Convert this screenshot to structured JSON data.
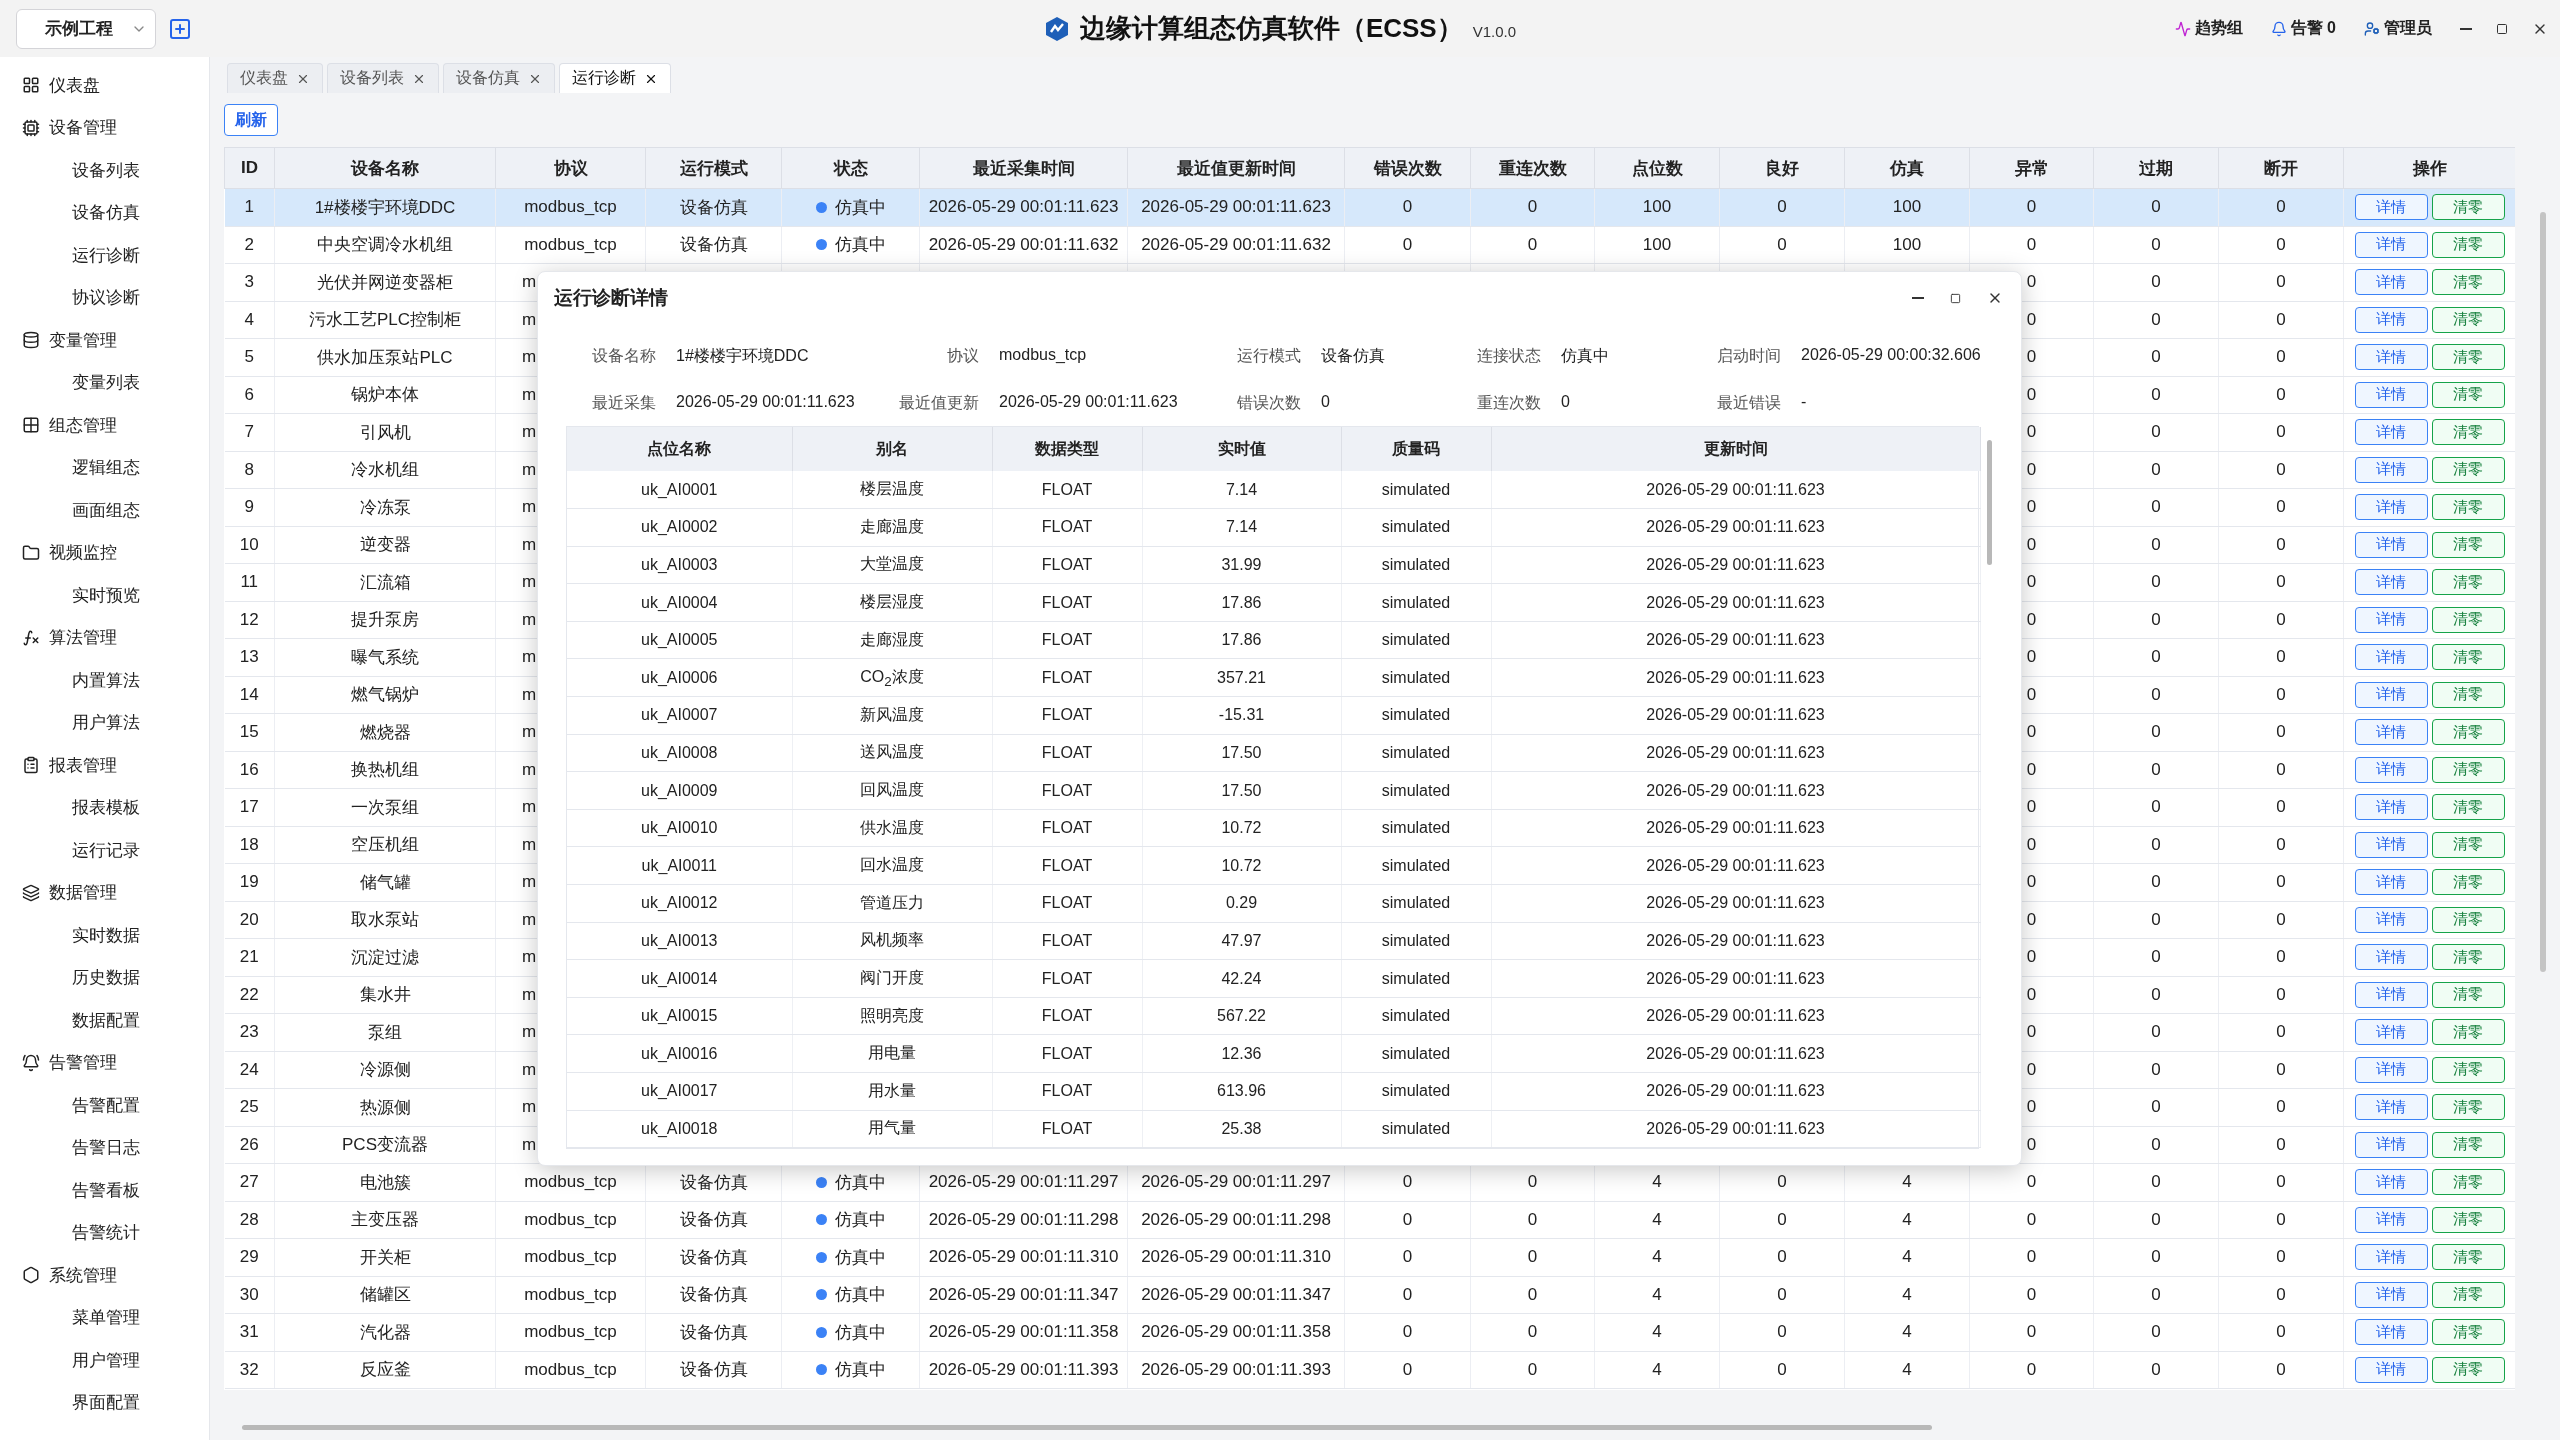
{
  "project": {
    "value": "示例工程"
  },
  "app": {
    "title": "边缘计算组态仿真软件（ECSS）",
    "version": "V1.0.0"
  },
  "header_actions": {
    "trend": "趋势组",
    "alarm_label": "告警",
    "alarm_count": "0",
    "user": "管理员"
  },
  "sidebar": {
    "groups": [
      {
        "label": "仪表盘"
      },
      {
        "label": "设备管理",
        "children": [
          {
            "label": "设备列表"
          },
          {
            "label": "设备仿真"
          },
          {
            "label": "运行诊断"
          },
          {
            "label": "协议诊断"
          }
        ]
      },
      {
        "label": "变量管理",
        "children": [
          {
            "label": "变量列表"
          }
        ]
      },
      {
        "label": "组态管理",
        "children": [
          {
            "label": "逻辑组态"
          },
          {
            "label": "画面组态"
          }
        ]
      },
      {
        "label": "视频监控",
        "children": [
          {
            "label": "实时预览"
          }
        ]
      },
      {
        "label": "算法管理",
        "children": [
          {
            "label": "内置算法"
          },
          {
            "label": "用户算法"
          }
        ]
      },
      {
        "label": "报表管理",
        "children": [
          {
            "label": "报表模板"
          },
          {
            "label": "运行记录"
          }
        ]
      },
      {
        "label": "数据管理",
        "children": [
          {
            "label": "实时数据"
          },
          {
            "label": "历史数据"
          },
          {
            "label": "数据配置"
          }
        ]
      },
      {
        "label": "告警管理",
        "children": [
          {
            "label": "告警配置"
          },
          {
            "label": "告警日志"
          },
          {
            "label": "告警看板"
          },
          {
            "label": "告警统计"
          }
        ]
      },
      {
        "label": "系统管理",
        "children": [
          {
            "label": "菜单管理"
          },
          {
            "label": "用户管理"
          },
          {
            "label": "界面配置"
          }
        ]
      }
    ]
  },
  "tabs": [
    {
      "label": "仪表盘",
      "selected": false
    },
    {
      "label": "设备列表",
      "selected": false
    },
    {
      "label": "设备仿真",
      "selected": false
    },
    {
      "label": "运行诊断",
      "selected": true
    }
  ],
  "toolbar": {
    "refresh": "刷新"
  },
  "main_table": {
    "columns": [
      "ID",
      "设备名称",
      "协议",
      "运行模式",
      "状态",
      "最近采集时间",
      "最近值更新时间",
      "错误次数",
      "重连次数",
      "点位数",
      "良好",
      "仿真",
      "异常",
      "过期",
      "断开",
      "操作"
    ],
    "rows": [
      {
        "kind": "full",
        "selected": true,
        "id": "1",
        "name": "1#楼楼宇环境DDC",
        "protocol": "modbus_tcp",
        "mode": "设备仿真",
        "status": "仿真中",
        "last_collect": "2026-05-29 00:01:11.623",
        "last_update": "2026-05-29 00:01:11.623",
        "errors": "0",
        "reconnects": "0",
        "points": "100",
        "good": "0",
        "simulated": "100",
        "abnormal": "0",
        "expired": "0",
        "disconnected": "0",
        "actions": [
          "详情",
          "清零"
        ]
      },
      {
        "kind": "full",
        "selected": false,
        "id": "2",
        "name": "中央空调冷水机组",
        "protocol": "modbus_tcp",
        "mode": "设备仿真",
        "status": "仿真中",
        "last_collect": "2026-05-29 00:01:11.632",
        "last_update": "2026-05-29 00:01:11.632",
        "errors": "0",
        "reconnects": "0",
        "points": "100",
        "good": "0",
        "simulated": "100",
        "abnormal": "0",
        "expired": "0",
        "disconnected": "0",
        "actions": [
          "详情",
          "清零"
        ]
      },
      {
        "kind": "covered",
        "selected": false,
        "id": "3",
        "name": "光伏并网逆变器柜",
        "protocol": "m",
        "abnormal": "0",
        "expired": "0",
        "disconnected": "0",
        "actions": [
          "详情",
          "清零"
        ]
      },
      {
        "kind": "covered",
        "selected": false,
        "id": "4",
        "name": "污水工艺PLC控制柜",
        "protocol": "m",
        "abnormal": "0",
        "expired": "0",
        "disconnected": "0",
        "actions": [
          "详情",
          "清零"
        ]
      },
      {
        "kind": "covered",
        "selected": false,
        "id": "5",
        "name": "供水加压泵站PLC",
        "protocol": "m",
        "abnormal": "0",
        "expired": "0",
        "disconnected": "0",
        "actions": [
          "详情",
          "清零"
        ]
      },
      {
        "kind": "covered",
        "selected": false,
        "id": "6",
        "name": "锅炉本体",
        "protocol": "m",
        "abnormal": "0",
        "expired": "0",
        "disconnected": "0",
        "actions": [
          "详情",
          "清零"
        ]
      },
      {
        "kind": "covered",
        "selected": false,
        "id": "7",
        "name": "引风机",
        "protocol": "m",
        "abnormal": "0",
        "expired": "0",
        "disconnected": "0",
        "actions": [
          "详情",
          "清零"
        ]
      },
      {
        "kind": "covered",
        "selected": false,
        "id": "8",
        "name": "冷水机组",
        "protocol": "m",
        "abnormal": "0",
        "expired": "0",
        "disconnected": "0",
        "actions": [
          "详情",
          "清零"
        ]
      },
      {
        "kind": "covered",
        "selected": false,
        "id": "9",
        "name": "冷冻泵",
        "protocol": "m",
        "abnormal": "0",
        "expired": "0",
        "disconnected": "0",
        "actions": [
          "详情",
          "清零"
        ]
      },
      {
        "kind": "covered",
        "selected": false,
        "id": "10",
        "name": "逆变器",
        "protocol": "m",
        "abnormal": "0",
        "expired": "0",
        "disconnected": "0",
        "actions": [
          "详情",
          "清零"
        ]
      },
      {
        "kind": "covered",
        "selected": false,
        "id": "11",
        "name": "汇流箱",
        "protocol": "m",
        "abnormal": "0",
        "expired": "0",
        "disconnected": "0",
        "actions": [
          "详情",
          "清零"
        ]
      },
      {
        "kind": "covered",
        "selected": false,
        "id": "12",
        "name": "提升泵房",
        "protocol": "m",
        "abnormal": "0",
        "expired": "0",
        "disconnected": "0",
        "actions": [
          "详情",
          "清零"
        ]
      },
      {
        "kind": "covered",
        "selected": false,
        "id": "13",
        "name": "曝气系统",
        "protocol": "m",
        "abnormal": "0",
        "expired": "0",
        "disconnected": "0",
        "actions": [
          "详情",
          "清零"
        ]
      },
      {
        "kind": "covered",
        "selected": false,
        "id": "14",
        "name": "燃气锅炉",
        "protocol": "m",
        "abnormal": "0",
        "expired": "0",
        "disconnected": "0",
        "actions": [
          "详情",
          "清零"
        ]
      },
      {
        "kind": "covered",
        "selected": false,
        "id": "15",
        "name": "燃烧器",
        "protocol": "m",
        "abnormal": "0",
        "expired": "0",
        "disconnected": "0",
        "actions": [
          "详情",
          "清零"
        ]
      },
      {
        "kind": "covered",
        "selected": false,
        "id": "16",
        "name": "换热机组",
        "protocol": "m",
        "abnormal": "0",
        "expired": "0",
        "disconnected": "0",
        "actions": [
          "详情",
          "清零"
        ]
      },
      {
        "kind": "covered",
        "selected": false,
        "id": "17",
        "name": "一次泵组",
        "protocol": "m",
        "abnormal": "0",
        "expired": "0",
        "disconnected": "0",
        "actions": [
          "详情",
          "清零"
        ]
      },
      {
        "kind": "covered",
        "selected": false,
        "id": "18",
        "name": "空压机组",
        "protocol": "m",
        "abnormal": "0",
        "expired": "0",
        "disconnected": "0",
        "actions": [
          "详情",
          "清零"
        ]
      },
      {
        "kind": "covered",
        "selected": false,
        "id": "19",
        "name": "储气罐",
        "protocol": "m",
        "abnormal": "0",
        "expired": "0",
        "disconnected": "0",
        "actions": [
          "详情",
          "清零"
        ]
      },
      {
        "kind": "covered",
        "selected": false,
        "id": "20",
        "name": "取水泵站",
        "protocol": "m",
        "abnormal": "0",
        "expired": "0",
        "disconnected": "0",
        "actions": [
          "详情",
          "清零"
        ]
      },
      {
        "kind": "covered",
        "selected": false,
        "id": "21",
        "name": "沉淀过滤",
        "protocol": "m",
        "abnormal": "0",
        "expired": "0",
        "disconnected": "0",
        "actions": [
          "详情",
          "清零"
        ]
      },
      {
        "kind": "covered",
        "selected": false,
        "id": "22",
        "name": "集水井",
        "protocol": "m",
        "abnormal": "0",
        "expired": "0",
        "disconnected": "0",
        "actions": [
          "详情",
          "清零"
        ]
      },
      {
        "kind": "covered",
        "selected": false,
        "id": "23",
        "name": "泵组",
        "protocol": "m",
        "abnormal": "0",
        "expired": "0",
        "disconnected": "0",
        "actions": [
          "详情",
          "清零"
        ]
      },
      {
        "kind": "covered",
        "selected": false,
        "id": "24",
        "name": "冷源侧",
        "protocol": "m",
        "abnormal": "0",
        "expired": "0",
        "disconnected": "0",
        "actions": [
          "详情",
          "清零"
        ]
      },
      {
        "kind": "covered",
        "selected": false,
        "id": "25",
        "name": "热源侧",
        "protocol": "m",
        "abnormal": "0",
        "expired": "0",
        "disconnected": "0",
        "actions": [
          "详情",
          "清零"
        ]
      },
      {
        "kind": "covered",
        "selected": false,
        "id": "26",
        "name": "PCS变流器",
        "protocol": "m",
        "abnormal": "0",
        "expired": "0",
        "disconnected": "0",
        "actions": [
          "详情",
          "清零"
        ]
      },
      {
        "kind": "full",
        "selected": false,
        "id": "27",
        "name": "电池簇",
        "protocol": "modbus_tcp",
        "mode": "设备仿真",
        "status": "仿真中",
        "last_collect": "2026-05-29 00:01:11.297",
        "last_update": "2026-05-29 00:01:11.297",
        "errors": "0",
        "reconnects": "0",
        "points": "4",
        "good": "0",
        "simulated": "4",
        "abnormal": "0",
        "expired": "0",
        "disconnected": "0",
        "actions": [
          "详情",
          "清零"
        ]
      },
      {
        "kind": "full",
        "selected": false,
        "id": "28",
        "name": "主变压器",
        "protocol": "modbus_tcp",
        "mode": "设备仿真",
        "status": "仿真中",
        "last_collect": "2026-05-29 00:01:11.298",
        "last_update": "2026-05-29 00:01:11.298",
        "errors": "0",
        "reconnects": "0",
        "points": "4",
        "good": "0",
        "simulated": "4",
        "abnormal": "0",
        "expired": "0",
        "disconnected": "0",
        "actions": [
          "详情",
          "清零"
        ]
      },
      {
        "kind": "full",
        "selected": false,
        "id": "29",
        "name": "开关柜",
        "protocol": "modbus_tcp",
        "mode": "设备仿真",
        "status": "仿真中",
        "last_collect": "2026-05-29 00:01:11.310",
        "last_update": "2026-05-29 00:01:11.310",
        "errors": "0",
        "reconnects": "0",
        "points": "4",
        "good": "0",
        "simulated": "4",
        "abnormal": "0",
        "expired": "0",
        "disconnected": "0",
        "actions": [
          "详情",
          "清零"
        ]
      },
      {
        "kind": "full",
        "selected": false,
        "id": "30",
        "name": "储罐区",
        "protocol": "modbus_tcp",
        "mode": "设备仿真",
        "status": "仿真中",
        "last_collect": "2026-05-29 00:01:11.347",
        "last_update": "2026-05-29 00:01:11.347",
        "errors": "0",
        "reconnects": "0",
        "points": "4",
        "good": "0",
        "simulated": "4",
        "abnormal": "0",
        "expired": "0",
        "disconnected": "0",
        "actions": [
          "详情",
          "清零"
        ]
      },
      {
        "kind": "full",
        "selected": false,
        "id": "31",
        "name": "汽化器",
        "protocol": "modbus_tcp",
        "mode": "设备仿真",
        "status": "仿真中",
        "last_collect": "2026-05-29 00:01:11.358",
        "last_update": "2026-05-29 00:01:11.358",
        "errors": "0",
        "reconnects": "0",
        "points": "4",
        "good": "0",
        "simulated": "4",
        "abnormal": "0",
        "expired": "0",
        "disconnected": "0",
        "actions": [
          "详情",
          "清零"
        ]
      },
      {
        "kind": "full",
        "selected": false,
        "id": "32",
        "name": "反应釜",
        "protocol": "modbus_tcp",
        "mode": "设备仿真",
        "status": "仿真中",
        "last_collect": "2026-05-29 00:01:11.393",
        "last_update": "2026-05-29 00:01:11.393",
        "errors": "0",
        "reconnects": "0",
        "points": "4",
        "good": "0",
        "simulated": "4",
        "abnormal": "0",
        "expired": "0",
        "disconnected": "0",
        "actions": [
          "详情",
          "清零"
        ]
      }
    ]
  },
  "dialog": {
    "title": "运行诊断详情",
    "info": [
      {
        "label": "设备名称",
        "value": "1#楼楼宇环境DDC"
      },
      {
        "label": "协议",
        "value": "modbus_tcp"
      },
      {
        "label": "运行模式",
        "value": "设备仿真"
      },
      {
        "label": "连接状态",
        "value": "仿真中"
      },
      {
        "label": "启动时间",
        "value": "2026-05-29 00:00:32.606"
      },
      {
        "label": "最近采集",
        "value": "2026-05-29 00:01:11.623"
      },
      {
        "label": "最近值更新",
        "value": "2026-05-29 00:01:11.623"
      },
      {
        "label": "错误次数",
        "value": "0"
      },
      {
        "label": "重连次数",
        "value": "0"
      },
      {
        "label": "最近错误",
        "value": "-"
      }
    ],
    "points": {
      "columns": [
        "点位名称",
        "别名",
        "数据类型",
        "实时值",
        "质量码",
        "更新时间"
      ],
      "rows": [
        {
          "name": "uk_AI0001",
          "alias": "楼层温度",
          "type": "FLOAT",
          "value": "7.14",
          "quality": "simulated",
          "time": "2026-05-29 00:01:11.623"
        },
        {
          "name": "uk_AI0002",
          "alias": "走廊温度",
          "type": "FLOAT",
          "value": "7.14",
          "quality": "simulated",
          "time": "2026-05-29 00:01:11.623"
        },
        {
          "name": "uk_AI0003",
          "alias": "大堂温度",
          "type": "FLOAT",
          "value": "31.99",
          "quality": "simulated",
          "time": "2026-05-29 00:01:11.623"
        },
        {
          "name": "uk_AI0004",
          "alias": "楼层湿度",
          "type": "FLOAT",
          "value": "17.86",
          "quality": "simulated",
          "time": "2026-05-29 00:01:11.623"
        },
        {
          "name": "uk_AI0005",
          "alias": "走廊湿度",
          "type": "FLOAT",
          "value": "17.86",
          "quality": "simulated",
          "time": "2026-05-29 00:01:11.623"
        },
        {
          "name": "uk_AI0006",
          "alias": "CO$_{2}$浓度",
          "type": "FLOAT",
          "value": "357.21",
          "quality": "simulated",
          "time": "2026-05-29 00:01:11.623"
        },
        {
          "name": "uk_AI0007",
          "alias": "新风温度",
          "type": "FLOAT",
          "value": "-15.31",
          "quality": "simulated",
          "time": "2026-05-29 00:01:11.623"
        },
        {
          "name": "uk_AI0008",
          "alias": "送风温度",
          "type": "FLOAT",
          "value": "17.50",
          "quality": "simulated",
          "time": "2026-05-29 00:01:11.623"
        },
        {
          "name": "uk_AI0009",
          "alias": "回风温度",
          "type": "FLOAT",
          "value": "17.50",
          "quality": "simulated",
          "time": "2026-05-29 00:01:11.623"
        },
        {
          "name": "uk_AI0010",
          "alias": "供水温度",
          "type": "FLOAT",
          "value": "10.72",
          "quality": "simulated",
          "time": "2026-05-29 00:01:11.623"
        },
        {
          "name": "uk_AI0011",
          "alias": "回水温度",
          "type": "FLOAT",
          "value": "10.72",
          "quality": "simulated",
          "time": "2026-05-29 00:01:11.623"
        },
        {
          "name": "uk_AI0012",
          "alias": "管道压力",
          "type": "FLOAT",
          "value": "0.29",
          "quality": "simulated",
          "time": "2026-05-29 00:01:11.623"
        },
        {
          "name": "uk_AI0013",
          "alias": "风机频率",
          "type": "FLOAT",
          "value": "47.97",
          "quality": "simulated",
          "time": "2026-05-29 00:01:11.623"
        },
        {
          "name": "uk_AI0014",
          "alias": "阀门开度",
          "type": "FLOAT",
          "value": "42.24",
          "quality": "simulated",
          "time": "2026-05-29 00:01:11.623"
        },
        {
          "name": "uk_AI0015",
          "alias": "照明亮度",
          "type": "FLOAT",
          "value": "567.22",
          "quality": "simulated",
          "time": "2026-05-29 00:01:11.623"
        },
        {
          "name": "uk_AI0016",
          "alias": "用电量",
          "type": "FLOAT",
          "value": "12.36",
          "quality": "simulated",
          "time": "2026-05-29 00:01:11.623"
        },
        {
          "name": "uk_AI0017",
          "alias": "用水量",
          "type": "FLOAT",
          "value": "613.96",
          "quality": "simulated",
          "time": "2026-05-29 00:01:11.623"
        },
        {
          "name": "uk_AI0018",
          "alias": "用气量",
          "type": "FLOAT",
          "value": "25.38",
          "quality": "simulated",
          "time": "2026-05-29 00:01:11.623"
        }
      ]
    }
  }
}
